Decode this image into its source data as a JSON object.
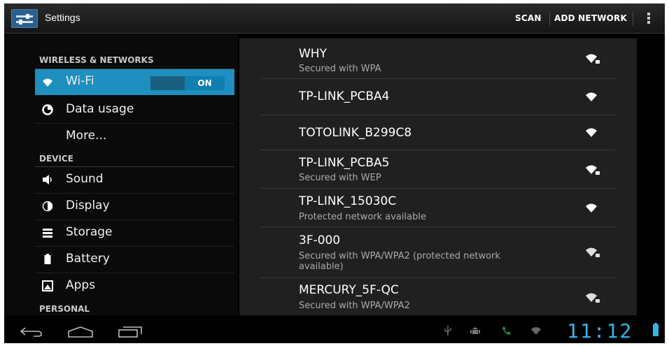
{
  "action_bar": {
    "title": "Settings",
    "scan_label": "SCAN",
    "add_network_label": "ADD NETWORK"
  },
  "sidebar": {
    "sections": [
      {
        "header": "WIRELESS & NETWORKS"
      },
      {
        "header": "DEVICE"
      },
      {
        "header": "PERSONAL"
      }
    ],
    "items": [
      {
        "label": "Wi-Fi",
        "icon": "wifi-icon",
        "toggle": "ON"
      },
      {
        "label": "Data usage",
        "icon": "data-usage-icon"
      },
      {
        "label": "More..."
      },
      {
        "label": "Sound",
        "icon": "sound-icon"
      },
      {
        "label": "Display",
        "icon": "display-icon"
      },
      {
        "label": "Storage",
        "icon": "storage-icon"
      },
      {
        "label": "Battery",
        "icon": "battery-icon"
      },
      {
        "label": "Apps",
        "icon": "apps-icon"
      }
    ]
  },
  "networks": [
    {
      "name": "WHY",
      "status": "Secured with WPA",
      "icon": "wifi-signal-locked-icon"
    },
    {
      "name": "TP-LINK_PCBA4",
      "status": "",
      "icon": "wifi-signal-icon"
    },
    {
      "name": "TOTOLINK_B299C8",
      "status": "",
      "icon": "wifi-signal-icon"
    },
    {
      "name": "TP-LINK_PCBA5",
      "status": "Secured with WEP",
      "icon": "wifi-signal-locked-icon"
    },
    {
      "name": "TP-LINK_15030C",
      "status": "Protected network available",
      "icon": "wifi-signal-icon"
    },
    {
      "name": "3F-000",
      "status": "Secured with WPA/WPA2 (protected network available)",
      "icon": "wifi-signal-locked-icon"
    },
    {
      "name": "MERCURY_5F-QC",
      "status": "Secured with WPA/WPA2",
      "icon": "wifi-signal-locked-icon"
    }
  ],
  "system_bar": {
    "clock": "11:12"
  },
  "colors": {
    "accent": "#34b5e5",
    "selected_item": "#1f8fbf"
  }
}
